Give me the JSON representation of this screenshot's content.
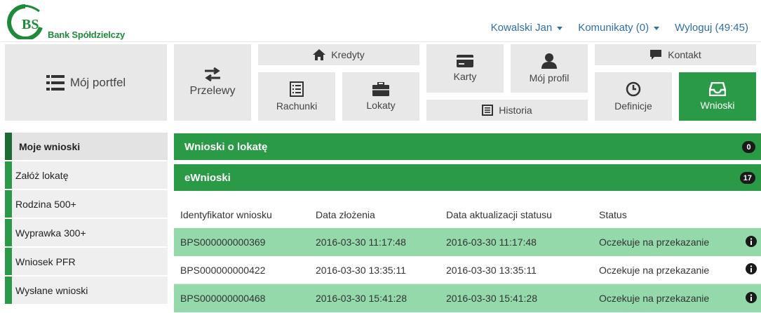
{
  "header": {
    "logo_mark": "BS",
    "logo_text": "Bank Spółdzielczy",
    "user_label": "Kowalski Jan",
    "messages_label": "Komunikaty (0)",
    "logout_label": "Wyloguj (49:45)"
  },
  "nav": {
    "portfel": "Mój portfel",
    "przelewy": "Przelewy",
    "kredyty": "Kredyty",
    "rachunki": "Rachunki",
    "lokaty": "Lokaty",
    "karty": "Karty",
    "profil": "Mój profil",
    "historia": "Historia",
    "kontakt": "Kontakt",
    "definicje": "Definicje",
    "wnioski": "Wnioski"
  },
  "sidebar": {
    "items": [
      {
        "label": "Moje wnioski"
      },
      {
        "label": "Załóż lokatę"
      },
      {
        "label": "Rodzina 500+"
      },
      {
        "label": "Wyprawka 300+"
      },
      {
        "label": "Wniosek PFR"
      },
      {
        "label": "Wysłane wnioski"
      }
    ]
  },
  "panels": {
    "lokaty": {
      "title": "Wnioski o lokatę",
      "count": "0"
    },
    "ewnioski": {
      "title": "eWnioski",
      "count": "17"
    }
  },
  "table": {
    "headers": [
      "Identyfikator wniosku",
      "Data złożenia",
      "Data aktualizacji statusu",
      "Status"
    ],
    "rows": [
      {
        "id": "BPS000000000369",
        "submitted": "2016-03-30 11:17:48",
        "updated": "2016-03-30 11:17:48",
        "status": "Oczekuje na przekazanie"
      },
      {
        "id": "BPS000000000422",
        "submitted": "2016-03-30 13:35:11",
        "updated": "2016-03-30 13:35:11",
        "status": "Oczekuje na przekazanie"
      },
      {
        "id": "BPS000000000468",
        "submitted": "2016-03-30 15:41:28",
        "updated": "2016-03-30 15:41:28",
        "status": "Oczekuje na przekazanie"
      }
    ]
  },
  "colors": {
    "brand_green": "#2b9a47",
    "row_green": "#93d9aa",
    "link_blue": "#2f6fa8",
    "tile_gray": "#e8e8e8"
  },
  "icons": {
    "portfel": "list-icon",
    "przelewy": "transfer-arrows-icon",
    "kredyty": "home-icon",
    "rachunki": "document-list-icon",
    "lokaty": "briefcase-icon",
    "karty": "credit-card-icon",
    "profil": "user-icon",
    "historia": "history-list-icon",
    "kontakt": "chat-bubble-icon",
    "definicje": "clock-icon",
    "wnioski": "inbox-icon",
    "row_info": "info-icon"
  }
}
